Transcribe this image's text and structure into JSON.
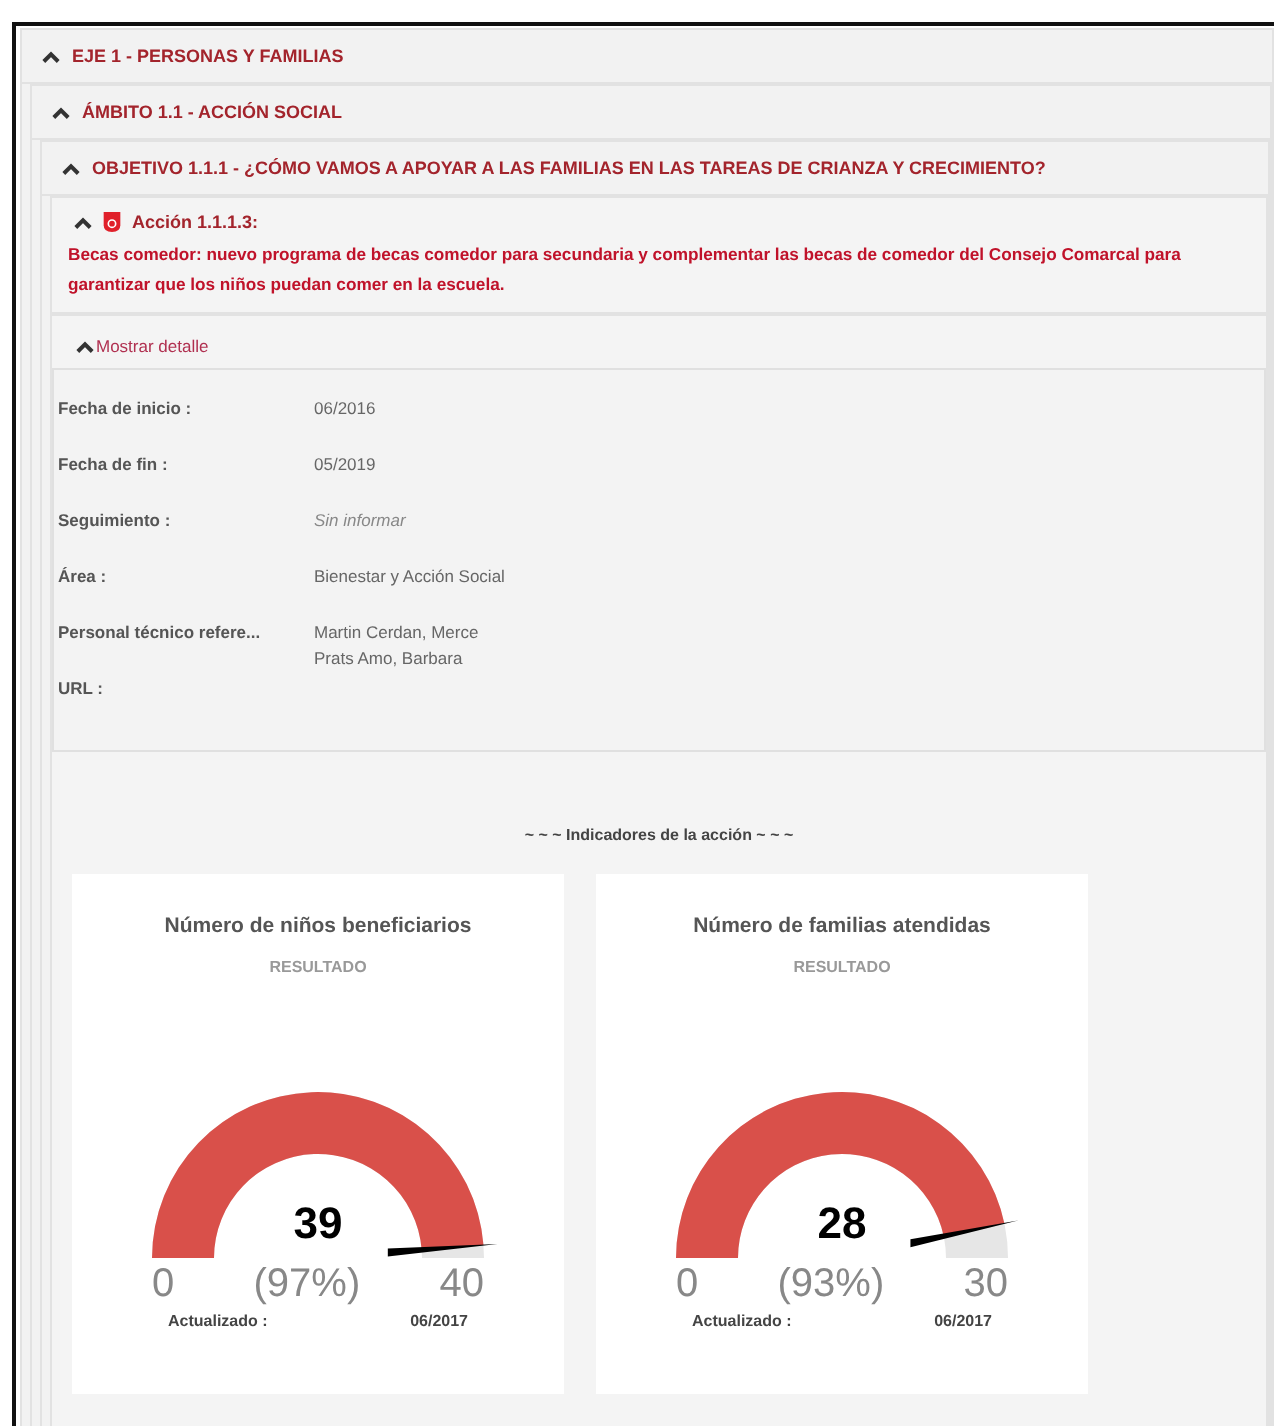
{
  "breadcrumbs": [
    {
      "label": "EJE 1 - PERSONAS Y FAMILIAS",
      "expanded": true
    },
    {
      "label": "ÁMBITO 1.1 - ACCIÓN SOCIAL",
      "expanded": true
    },
    {
      "label": "OBJETIVO 1.1.1 - ¿CÓMO VAMOS A APOYAR A LAS FAMILIAS EN LAS TAREAS DE CRIANZA Y CRECIMIENTO?",
      "expanded": true
    }
  ],
  "action": {
    "title": "Acción 1.1.1.3:",
    "description": "Becas comedor: nuevo programa de becas comedor para secundaria y complementar las becas de comedor del Consejo Comarcal para garantizar que los niños puedan comer en la escuela.",
    "expanded": true
  },
  "detail_toggle": {
    "label": "Mostrar detalle",
    "expanded": true
  },
  "details": [
    {
      "label": "Fecha de inicio :",
      "values": [
        "06/2016"
      ],
      "kind": "value"
    },
    {
      "label": "Fecha de fin :",
      "values": [
        "05/2019"
      ],
      "kind": "value"
    },
    {
      "label": "Seguimiento :",
      "values": [
        "Sin informar"
      ],
      "kind": "empty"
    },
    {
      "label": "Área :",
      "values": [
        "Bienestar y Acción Social"
      ],
      "kind": "value"
    },
    {
      "label": "Personal técnico refere...",
      "values": [
        "Martin Cerdan, Merce",
        "Prats Amo, Barbara"
      ],
      "kind": "value"
    },
    {
      "label": "URL :"
    }
  ],
  "indicators_heading": "~ ~ ~ Indicadores de la acción ~ ~ ~",
  "indicators": [
    {
      "title": "Número de niños beneficiarios",
      "subtitle": "RESULTADO",
      "value": "39",
      "percent": "(97%)",
      "min": "0",
      "max": "40",
      "level": 0.975,
      "updated_label": "Actualizado :",
      "updated": "06/2017"
    },
    {
      "title": "Número de familias atendidas",
      "subtitle": "RESULTADO",
      "value": "28",
      "percent": "(93%)",
      "min": "0",
      "max": "30",
      "level": 0.933,
      "updated_label": "Actualizado :",
      "updated": "06/2017"
    }
  ]
}
